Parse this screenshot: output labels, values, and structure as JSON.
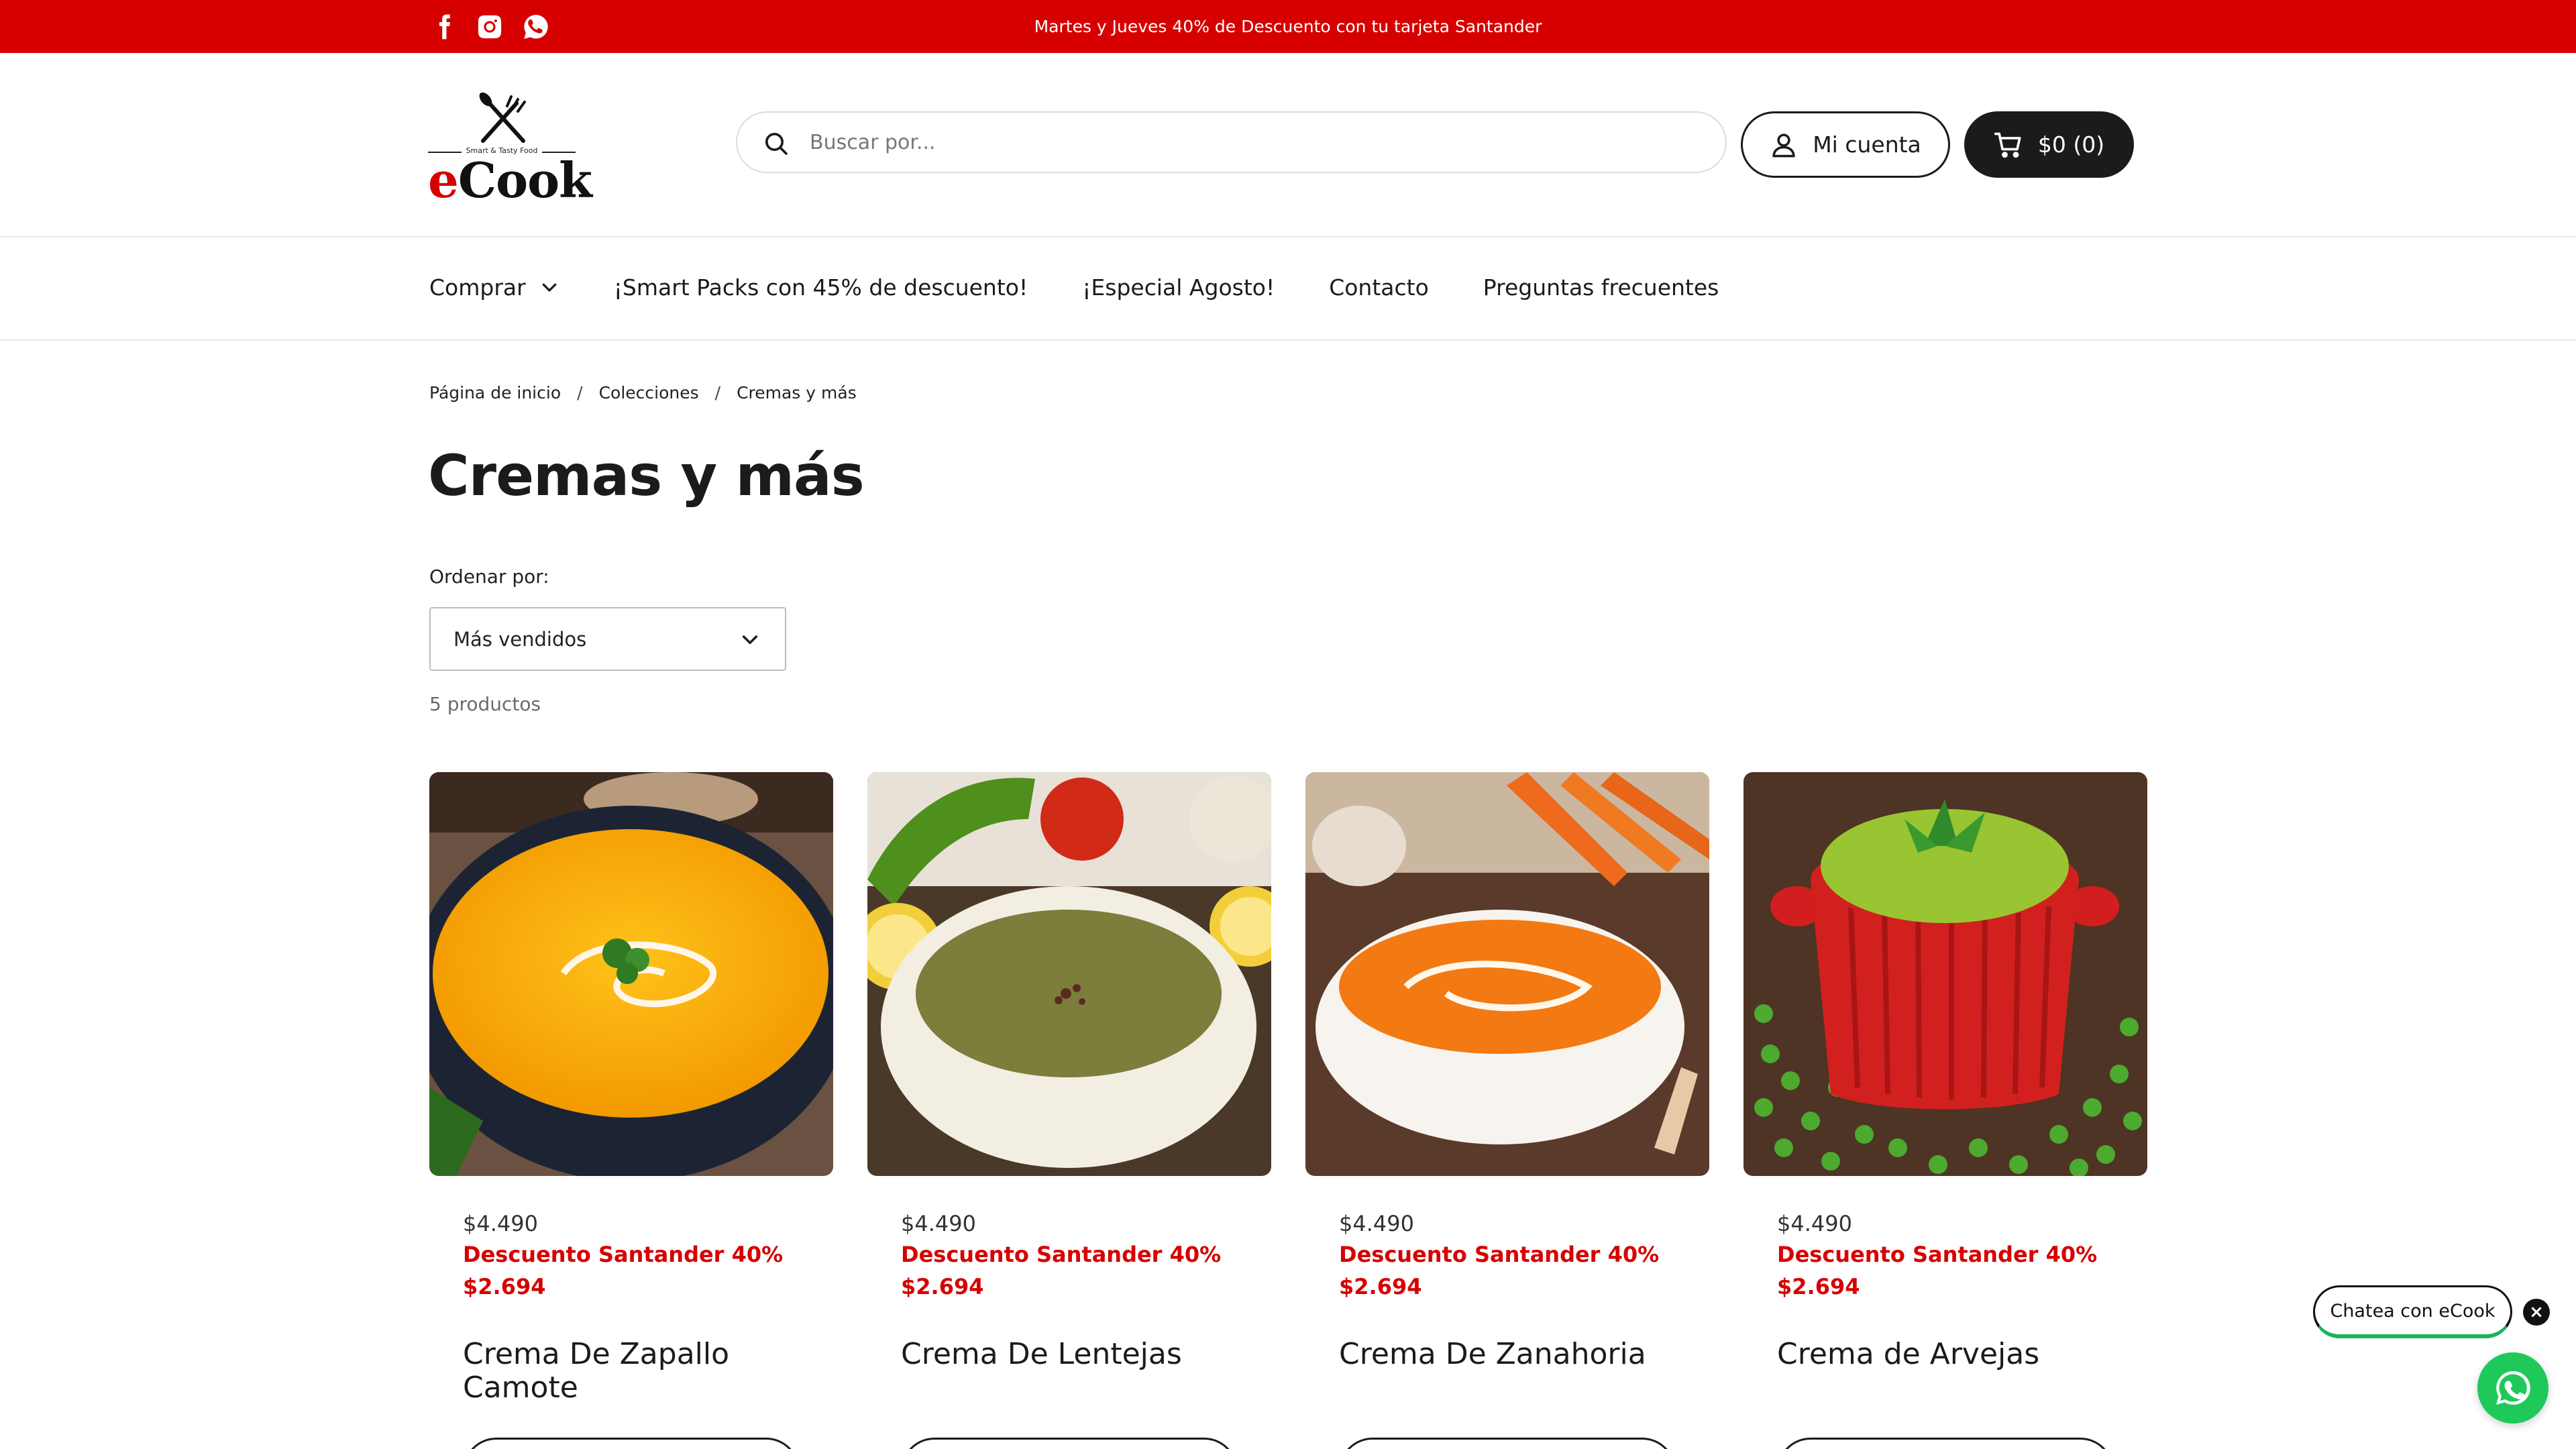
{
  "announcement": {
    "text": "Martes y Jueves 40% de Descuento con tu tarjeta Santander",
    "social_icons": [
      "facebook-icon",
      "instagram-icon",
      "whatsapp-icon"
    ]
  },
  "header": {
    "logo": {
      "word_prefix": "e",
      "word_rest": "Cook",
      "tagline": "Smart & Tasty Food"
    },
    "search": {
      "placeholder": "Buscar por..."
    },
    "account_label": "Mi cuenta",
    "cart_label": "$0 (0)"
  },
  "nav": {
    "items": [
      {
        "label": "Comprar",
        "has_dropdown": true
      },
      {
        "label": "¡Smart Packs con 45% de descuento!"
      },
      {
        "label": "¡Especial Agosto!"
      },
      {
        "label": "Contacto"
      },
      {
        "label": "Preguntas frecuentes"
      }
    ]
  },
  "breadcrumb": {
    "items": [
      "Página de inicio",
      "Colecciones",
      "Cremas y más"
    ],
    "separator": "/"
  },
  "collection": {
    "title": "Cremas y más",
    "sort_label": "Ordenar por:",
    "sort_value": "Más vendidos",
    "count": "5 productos"
  },
  "products": [
    {
      "name": "Crema De Zapallo Camote",
      "price": "$4.490",
      "discount_label": "Descuento Santander 40%",
      "discount_price": "$2.694",
      "image": "pumpkin-cream-soup"
    },
    {
      "name": "Crema De Lentejas",
      "price": "$4.490",
      "discount_label": "Descuento Santander 40%",
      "discount_price": "$2.694",
      "image": "lentil-cream-soup"
    },
    {
      "name": "Crema De Zanahoria",
      "price": "$4.490",
      "discount_label": "Descuento Santander 40%",
      "discount_price": "$2.694",
      "image": "carrot-cream-soup"
    },
    {
      "name": "Crema de Arvejas",
      "price": "$4.490",
      "discount_label": "Descuento Santander 40%",
      "discount_price": "$2.694",
      "image": "pea-cream-soup"
    }
  ],
  "chat": {
    "bubble_text": "Chatea con eCook",
    "close_icon": "close-icon",
    "fab_icon": "whatsapp-icon"
  },
  "colors": {
    "accent": "#d60000",
    "dark": "#1b1b1b",
    "whatsapp": "#1ec95a"
  }
}
